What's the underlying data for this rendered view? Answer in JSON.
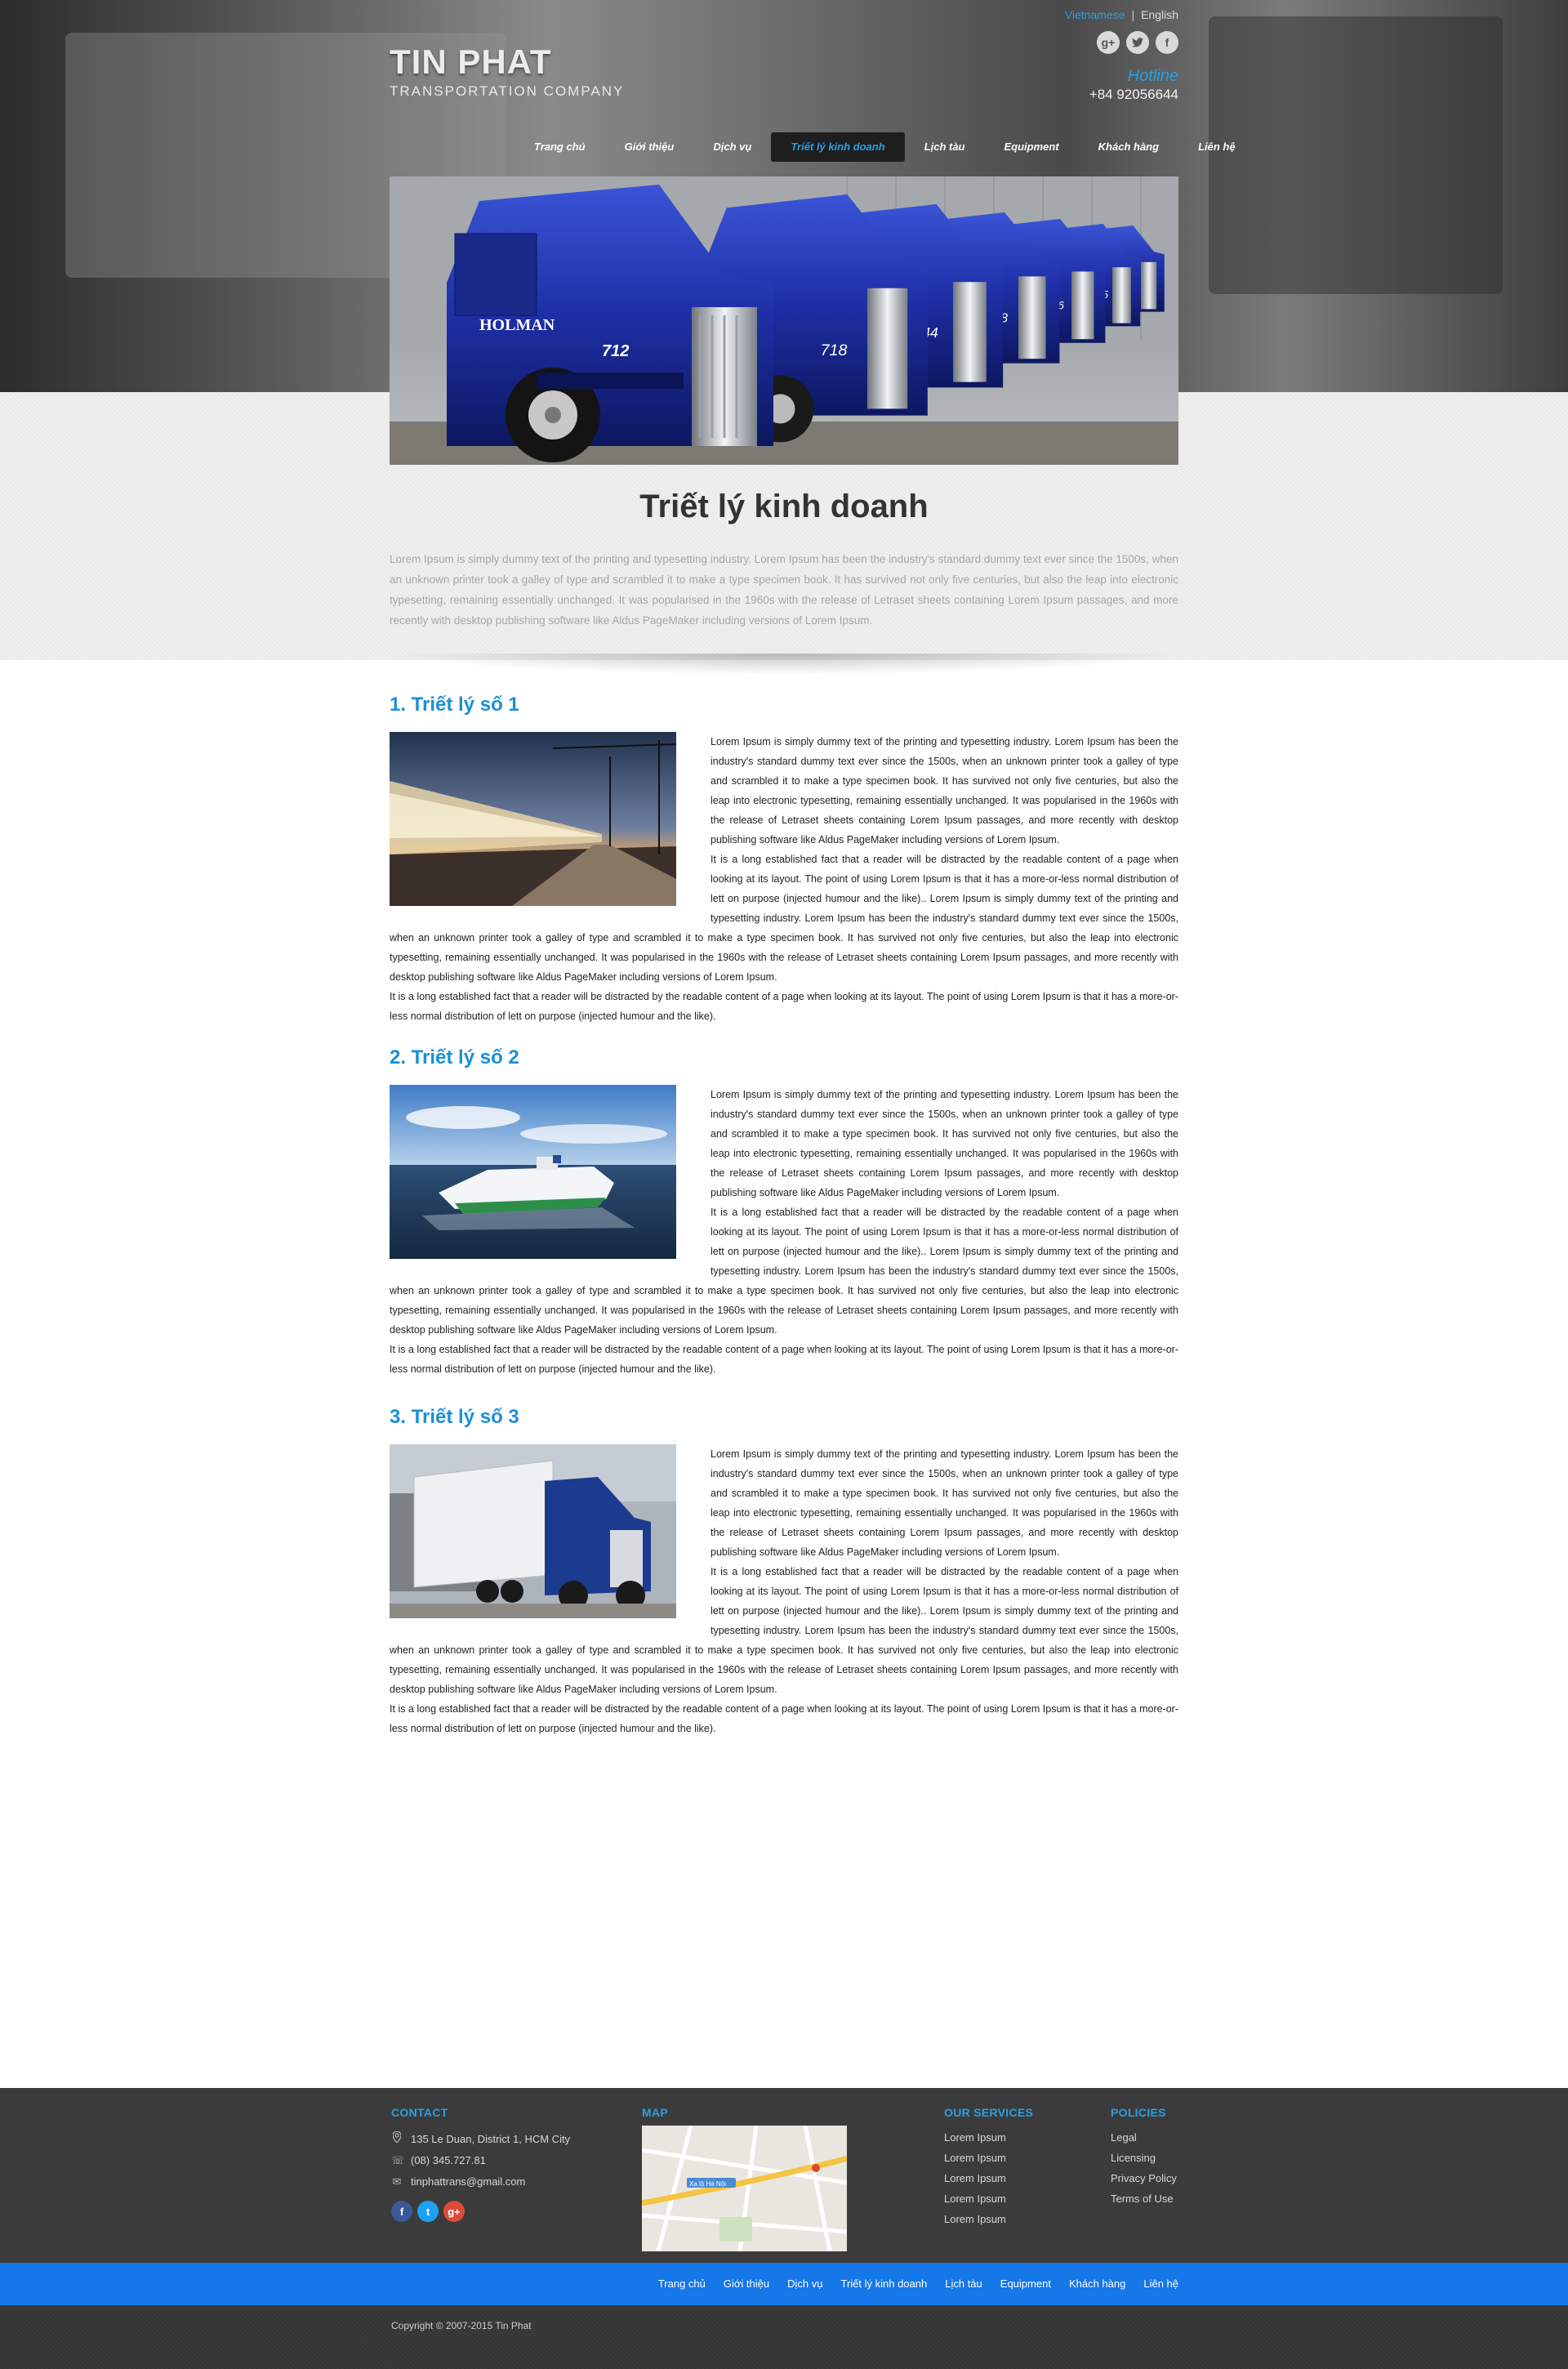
{
  "lang": {
    "vietnamese": "Vietnamese",
    "separator": "|",
    "english": "English"
  },
  "social": [
    {
      "icon": "google-plus-icon",
      "glyph": "g+"
    },
    {
      "icon": "twitter-icon",
      "glyph": "t"
    },
    {
      "icon": "facebook-icon",
      "glyph": "f"
    }
  ],
  "brand": {
    "title": "TIN PHAT",
    "subtitle": "TRANSPORTATION COMPANY"
  },
  "hotline": {
    "label": "Hotline",
    "number": "+84 92056644"
  },
  "nav": [
    {
      "label": "Trang chủ",
      "active": false
    },
    {
      "label": "Giới thiệu",
      "active": false
    },
    {
      "label": "Dịch vụ",
      "active": false
    },
    {
      "label": "Triết lý kinh doanh",
      "active": true
    },
    {
      "label": "Lịch tàu",
      "active": false
    },
    {
      "label": "Equipment",
      "active": false
    },
    {
      "label": "Khách hàng",
      "active": false
    },
    {
      "label": "Liên hệ",
      "active": false
    }
  ],
  "hero": {
    "truck_numbers": [
      "712",
      "718",
      "744",
      "738",
      "766",
      "735"
    ],
    "brand_text": "HOLMAN"
  },
  "page": {
    "title": "Triết lý kinh doanh",
    "intro": "Lorem Ipsum is simply dummy text of the printing and typesetting industry. Lorem Ipsum has been the industry's standard dummy text ever since the 1500s, when an unknown printer took a galley of type and scrambled it to make a type specimen book. It has survived not only five centuries, but also the leap into electronic typesetting, remaining essentially unchanged. It was popularised in the 1960s with the release of Letraset sheets containing Lorem Ipsum passages, and more recently with desktop publishing software like Aldus PageMaker including versions of Lorem Ipsum."
  },
  "sections": [
    {
      "title": "1. Triết lý số 1",
      "p1": "Lorem Ipsum is simply dummy text of the printing and typesetting industry. Lorem Ipsum has been the industry's standard dummy text ever since the 1500s, when an unknown printer took a galley of type and scrambled it to make a type specimen book. It has survived not only five centuries, but also the leap into electronic typesetting, remaining essentially unchanged. It was popularised in the 1960s with the release of Letraset sheets containing Lorem Ipsum passages, and more recently with desktop publishing software like Aldus PageMaker including versions of Lorem Ipsum.",
      "p2": "It is a long established fact that a reader will be distracted by the readable content of a page when looking at its layout. The point of using Lorem Ipsum is that it has a more-or-less normal distribution of lett on purpose (injected humour and the like).. Lorem Ipsum is simply dummy text of the printing and typesetting industry. Lorem Ipsum has been the industry's standard dummy text ever since the 1500s, when an unknown printer took a galley of type and scrambled it to make a type specimen book. It has survived not only five centuries, but also the leap into electronic typesetting, remaining essentially unchanged. It was popularised in the 1960s with the release of Letraset sheets containing Lorem Ipsum passages, and more recently with desktop publishing software like Aldus PageMaker including versions of Lorem Ipsum.",
      "p3": "It is a long established fact that a reader will be distracted by the readable content of a page when looking at its layout. The point of using Lorem Ipsum is that it has a more-or-less normal distribution of lett on purpose (injected humour and the like)."
    },
    {
      "title": "2. Triết lý số 2",
      "p1": "Lorem Ipsum is simply dummy text of the printing and typesetting industry. Lorem Ipsum has been the industry's standard dummy text ever since the 1500s, when an unknown printer took a galley of type and scrambled it to make a type specimen book. It has survived not only five centuries, but also the leap into electronic typesetting, remaining essentially unchanged. It was popularised in the 1960s with the release of Letraset sheets containing Lorem Ipsum passages, and more recently with desktop publishing software like Aldus PageMaker including versions of Lorem Ipsum.",
      "p2": "It is a long established fact that a reader will be distracted by the readable content of a page when looking at its layout. The point of using Lorem Ipsum is that it has a more-or-less normal distribution of lett on purpose (injected humour and the like).. Lorem Ipsum is simply dummy text of the printing and typesetting industry. Lorem Ipsum has been the industry's standard dummy text ever since the 1500s, when an unknown printer took a galley of type and scrambled it to make a type specimen book. It has survived not only five centuries, but also the leap into electronic typesetting, remaining essentially unchanged. It was popularised in the 1960s with the release of Letraset sheets containing Lorem Ipsum passages, and more recently with desktop publishing software like Aldus PageMaker including versions of Lorem Ipsum.",
      "p3": "It is a long established fact that a reader will be distracted by the readable content of a page when looking at its layout. The point of using Lorem Ipsum is that it has a more-or-less normal distribution of lett on purpose (injected humour and the like)."
    },
    {
      "title": "3. Triết lý số 3",
      "p1": "Lorem Ipsum is simply dummy text of the printing and typesetting industry. Lorem Ipsum has been the industry's standard dummy text ever since the 1500s, when an unknown printer took a galley of type and scrambled it to make a type specimen book. It has survived not only five centuries, but also the leap into electronic typesetting, remaining essentially unchanged. It was popularised in the 1960s with the release of Letraset sheets containing Lorem Ipsum passages, and more recently with desktop publishing software like Aldus PageMaker including versions of Lorem Ipsum.",
      "p2": "It is a long established fact that a reader will be distracted by the readable content of a page when looking at its layout. The point of using Lorem Ipsum is that it has a more-or-less normal distribution of lett on purpose (injected humour and the like).. Lorem Ipsum is simply dummy text of the printing and typesetting industry. Lorem Ipsum has been the industry's standard dummy text ever since the 1500s, when an unknown printer took a galley of type and scrambled it to make a type specimen book. It has survived not only five centuries, but also the leap into electronic typesetting, remaining essentially unchanged. It was popularised in the 1960s with the release of Letraset sheets containing Lorem Ipsum passages, and more recently with desktop publishing software like Aldus PageMaker including versions of Lorem Ipsum.",
      "p3": "It is a long established fact that a reader will be distracted by the readable content of a page when looking at its layout. The point of using Lorem Ipsum is that it has a more-or-less normal distribution of lett on purpose (injected humour and the like)."
    }
  ],
  "footer": {
    "contact": {
      "heading": "CONTACT",
      "address": "135 Le Duan, District 1, HCM City",
      "phone": "(08) 345.727.81",
      "email": "tinphattrans@gmail.com",
      "social": [
        {
          "icon": "facebook-icon",
          "glyph": "f",
          "color": "#3b5998"
        },
        {
          "icon": "twitter-icon",
          "glyph": "t",
          "color": "#1da1f2"
        },
        {
          "icon": "google-plus-icon",
          "glyph": "g+",
          "color": "#dd4b39"
        }
      ]
    },
    "map": {
      "heading": "MAP",
      "street": "Xa lộ Hà Nội"
    },
    "services": {
      "heading": "OUR SERVICES",
      "items": [
        "Lorem Ipsum",
        "Lorem Ipsum",
        "Lorem Ipsum",
        "Lorem Ipsum",
        "Lorem Ipsum"
      ]
    },
    "policies": {
      "heading": "POLICIES",
      "items": [
        "Legal",
        "Licensing",
        "Privacy Policy",
        "Terms of Use"
      ]
    }
  },
  "bottom_nav": [
    "Trang chủ",
    "Giới thiệu",
    "Dịch vụ",
    "Triết lý kinh doanh",
    "Lịch tàu",
    "Equipment",
    "Khách hàng",
    "Liên hệ"
  ],
  "copyright": "Copyright © 2007-2015 Tin Phat",
  "colors": {
    "accent": "#2a9fe4",
    "heading_blue": "#1a8fd8",
    "footer_bg": "#3b3b3b",
    "bar_blue": "#1577e8"
  }
}
